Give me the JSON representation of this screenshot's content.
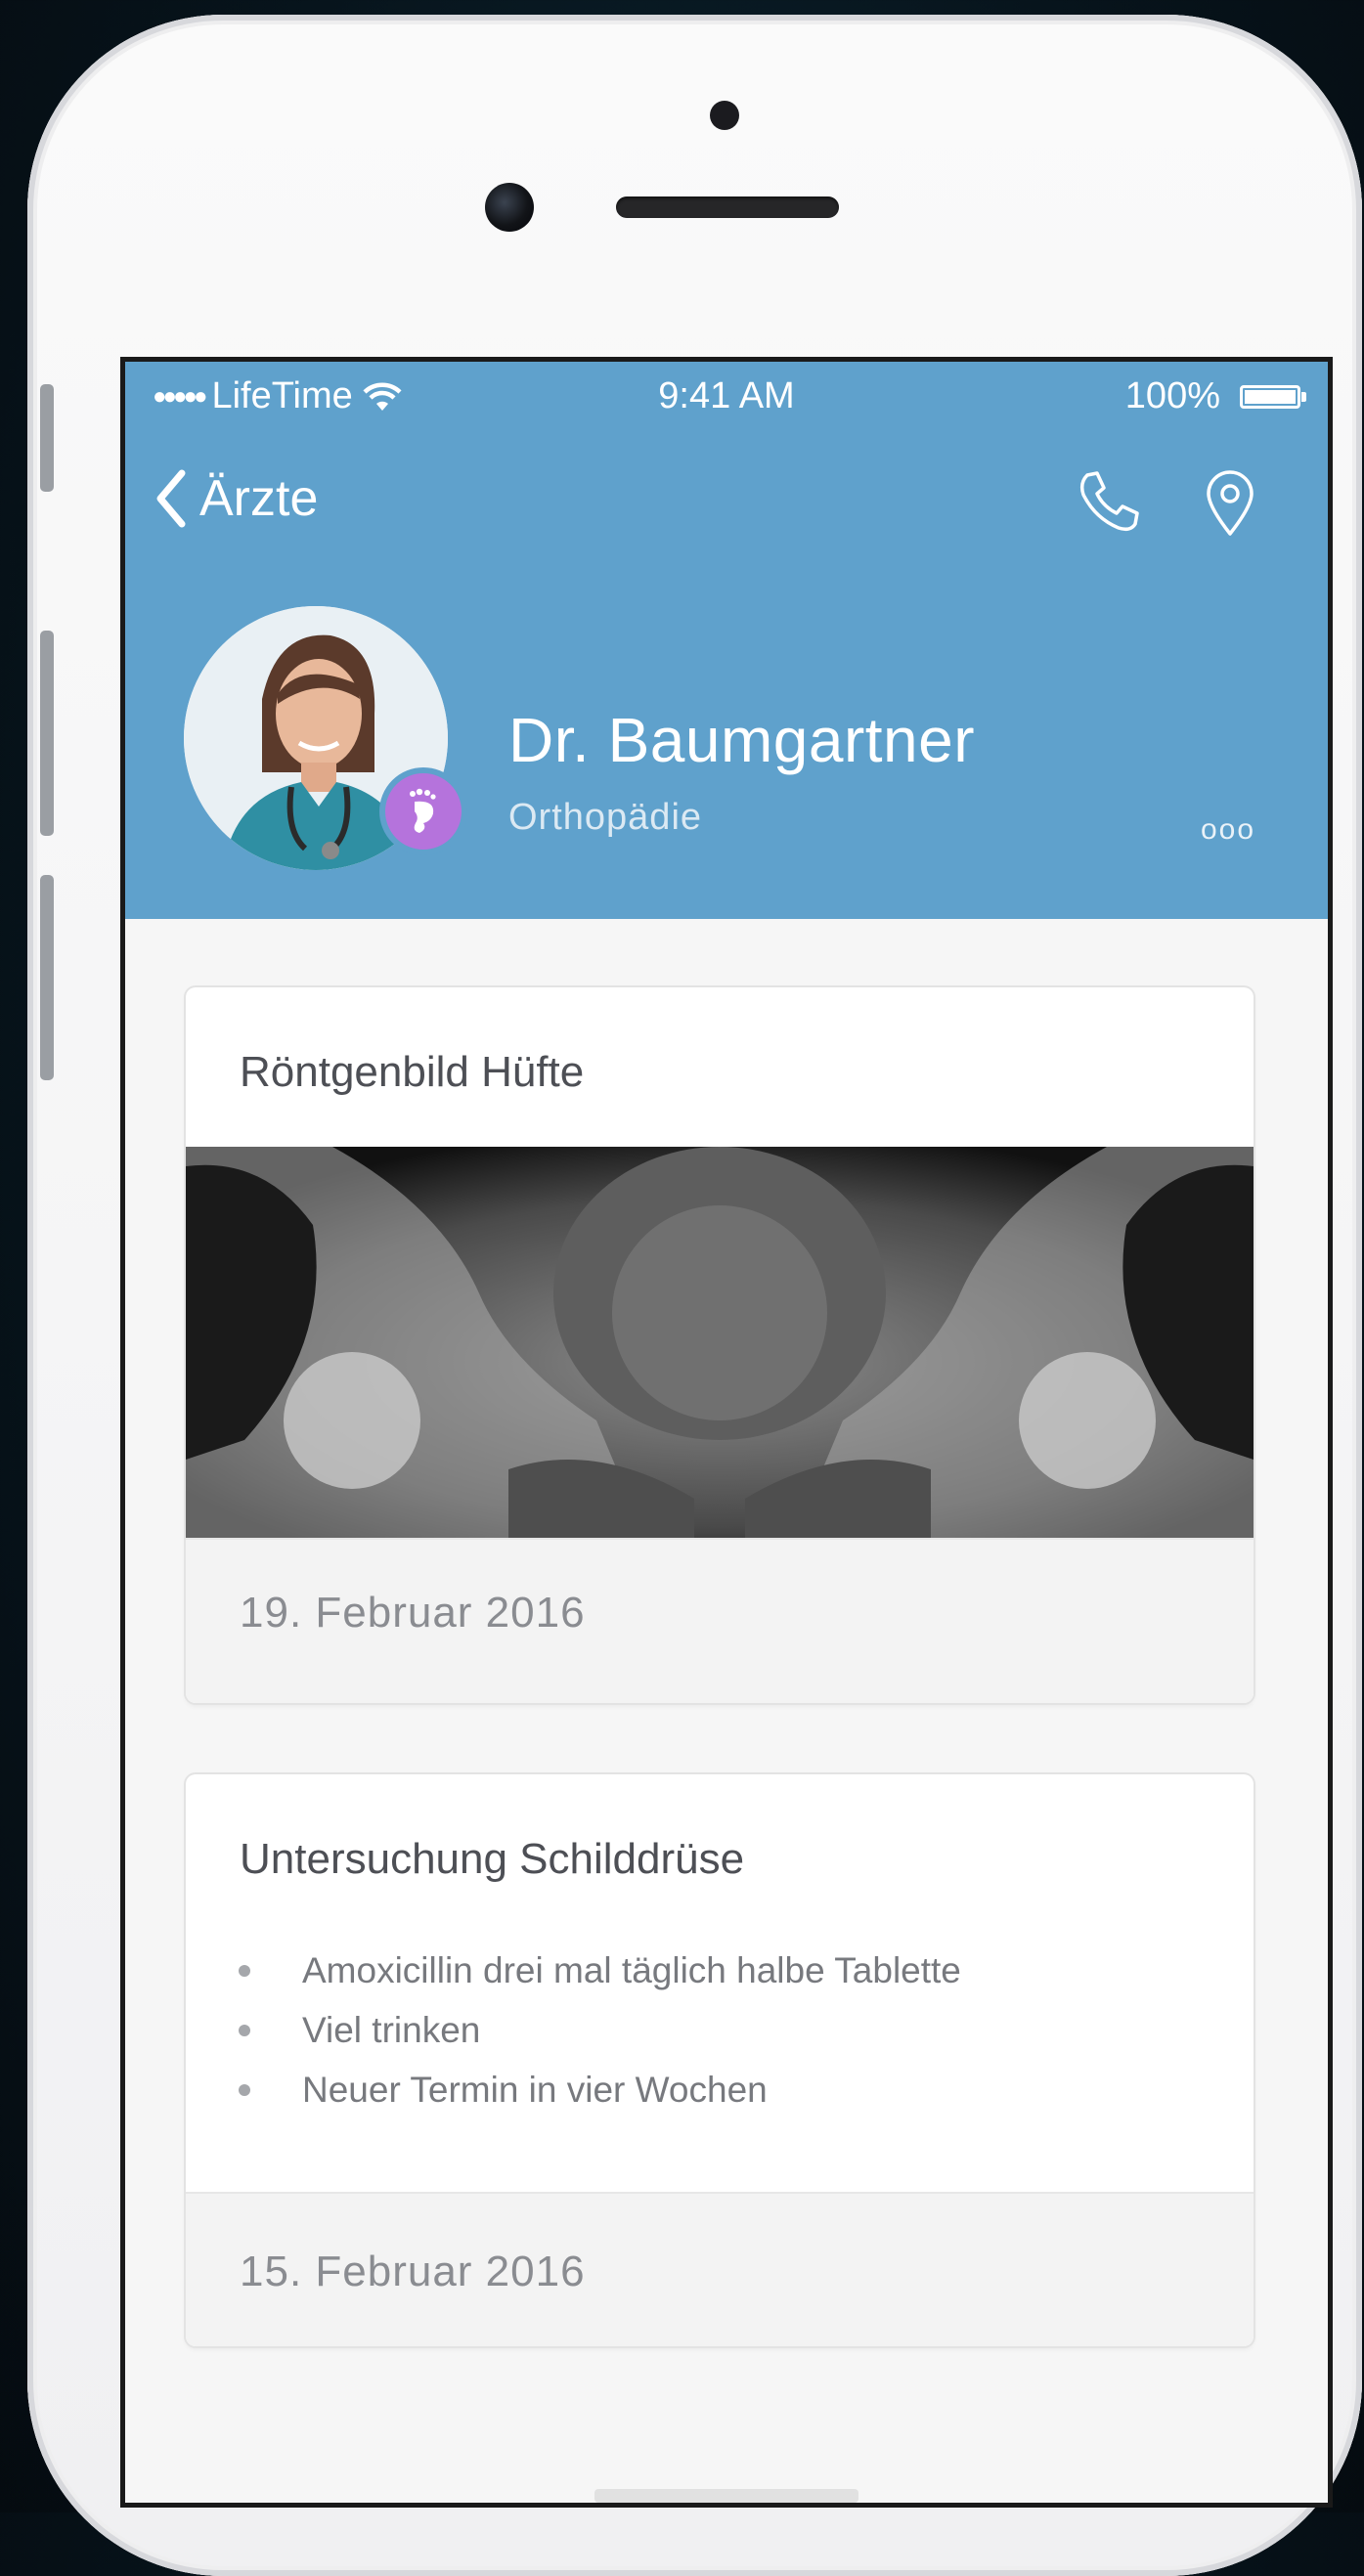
{
  "status_bar": {
    "signal_dots": "●●●●●",
    "carrier": "LifeTime",
    "time": "9:41 AM",
    "battery": "100%"
  },
  "nav": {
    "back_label": "Ärzte"
  },
  "doctor": {
    "name": "Dr. Baumgartner",
    "specialty": "Orthopädie",
    "more": "ooo"
  },
  "cards": [
    {
      "title": "Röntgenbild Hüfte",
      "date": "19. Februar 2016"
    },
    {
      "title": "Untersuchung Schilddrüse",
      "notes": [
        "Amoxicillin drei mal täglich halbe Tablette",
        "Viel trinken",
        "Neuer Termin in vier Wochen"
      ],
      "date": "15. Februar 2016"
    }
  ],
  "colors": {
    "header": "#5fa1cc",
    "badge": "#b573dc",
    "background": "#f6f6f6"
  },
  "icons": {
    "back": "chevron-left-icon",
    "call": "phone-icon",
    "location": "map-pin-icon",
    "specialty": "foot-icon",
    "wifi": "wifi-icon"
  }
}
